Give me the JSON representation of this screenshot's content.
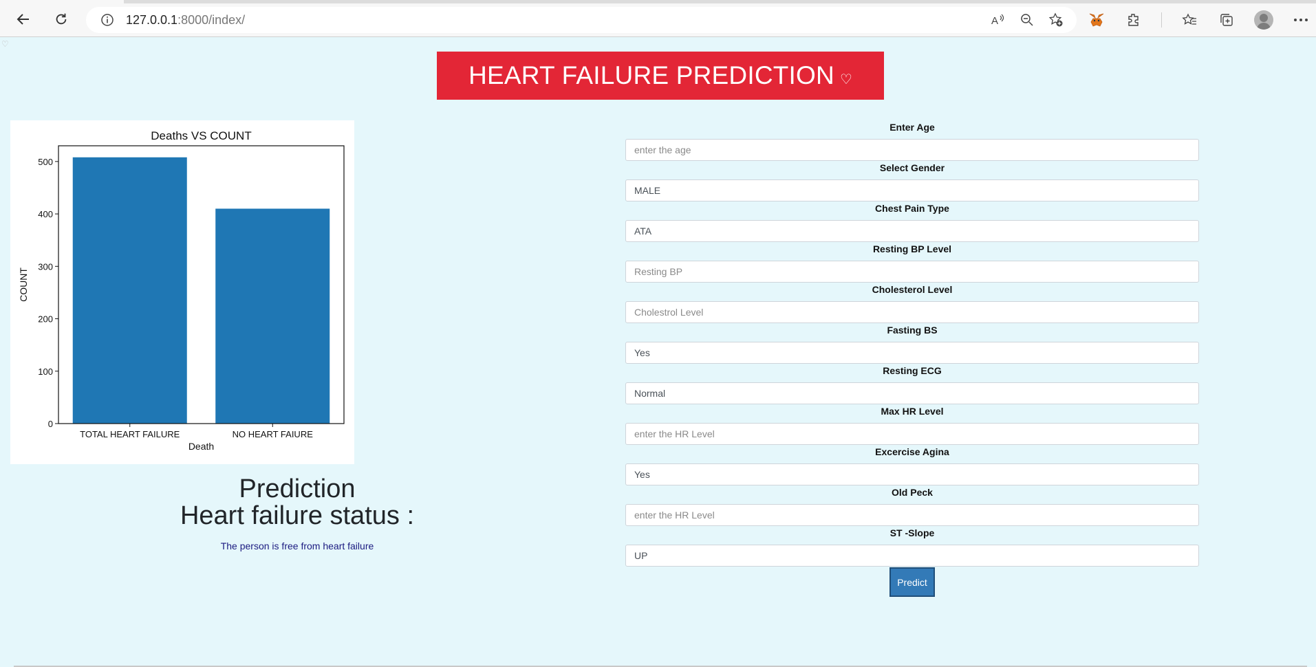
{
  "browser": {
    "url_host": "127.0.0.1",
    "url_path": ":8000/index/",
    "icons": [
      "back-icon",
      "refresh-icon",
      "info-icon",
      "read-aloud-icon",
      "zoom-out-icon",
      "add-favorite-icon",
      "metamask-icon",
      "extensions-icon",
      "favorites-icon",
      "collections-icon",
      "profile-icon",
      "more-icon"
    ]
  },
  "header": {
    "title": "HEART FAILURE PREDICTION",
    "heart": "♡"
  },
  "chart_data": {
    "type": "bar",
    "title": "Deaths VS COUNT",
    "xlabel": "Death",
    "ylabel": "COUNT",
    "categories": [
      "TOTAL HEART FAILURE",
      "NO HEART FAIURE"
    ],
    "values": [
      508,
      410
    ],
    "ylim": [
      0,
      530
    ],
    "yticks": [
      0,
      100,
      200,
      300,
      400,
      500
    ],
    "bar_color": "#1f77b4",
    "grid": false
  },
  "prediction": {
    "heading": "Prediction",
    "status_label": "Heart failure status :",
    "message": "The person is free from heart failure"
  },
  "form": {
    "fields": [
      {
        "label": "Enter Age",
        "value": "",
        "placeholder": "enter the age"
      },
      {
        "label": "Select Gender",
        "value": "MALE",
        "placeholder": ""
      },
      {
        "label": "Chest Pain Type",
        "value": "ATA",
        "placeholder": ""
      },
      {
        "label": "Resting BP Level",
        "value": "",
        "placeholder": "Resting BP"
      },
      {
        "label": "Cholesterol Level",
        "value": "",
        "placeholder": "Cholestrol Level"
      },
      {
        "label": "Fasting BS",
        "value": "Yes",
        "placeholder": ""
      },
      {
        "label": "Resting ECG",
        "value": "Normal",
        "placeholder": ""
      },
      {
        "label": "Max HR Level",
        "value": "",
        "placeholder": "enter the HR Level"
      },
      {
        "label": "Excercise Agina",
        "value": "Yes",
        "placeholder": ""
      },
      {
        "label": "Old Peck",
        "value": "",
        "placeholder": "enter the HR Level"
      },
      {
        "label": "ST -Slope",
        "value": "UP",
        "placeholder": ""
      }
    ],
    "submit_label": "Predict"
  },
  "colors": {
    "banner": "#e32636",
    "page_bg": "#e5f7fb",
    "button": "#337ab7"
  }
}
